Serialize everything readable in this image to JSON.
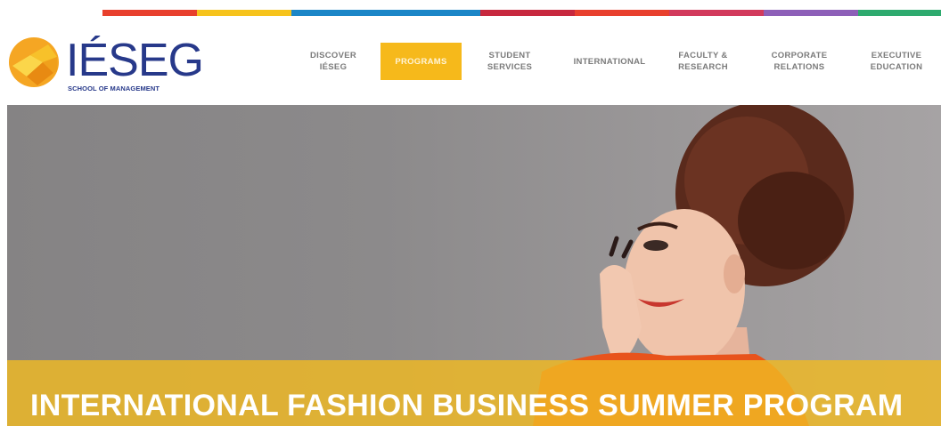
{
  "header": {
    "logo_text": "IÉSEG",
    "logo_subtitle": "SCHOOL OF MANAGEMENT",
    "strip_colors": [
      "#f08a1c",
      "#e8402d",
      "#f6c31c",
      "#1b86c7",
      "#1b86c7",
      "#c7283e",
      "#e8402d",
      "#d23a5c",
      "#8d5fb8",
      "#2eaa6e"
    ]
  },
  "nav": {
    "items": [
      {
        "label": "DISCOVER\nIÉSEG",
        "active": false
      },
      {
        "label": "PROGRAMS",
        "active": true
      },
      {
        "label": "STUDENT\nSERVICES",
        "active": false
      },
      {
        "label": "INTERNATIONAL",
        "active": false
      },
      {
        "label": "FACULTY &\nRESEARCH",
        "active": false
      },
      {
        "label": "CORPORATE\nRELATIONS",
        "active": false
      },
      {
        "label": "EXECUTIVE\nEDUCATION",
        "active": false
      }
    ]
  },
  "hero": {
    "title": "INTERNATIONAL FASHION BUSINESS SUMMER PROGRAM",
    "banner_color": "#f0ba22"
  }
}
